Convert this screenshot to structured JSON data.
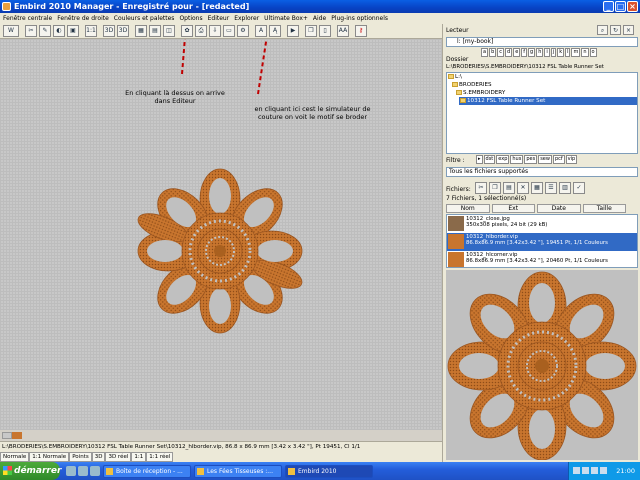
{
  "window": {
    "title": "Embird 2010 Manager - Enregistré pour - [redacted]"
  },
  "menu": [
    "Fenêtre centrale",
    "Fenêtre de droite",
    "Couleurs et palettes",
    "Options",
    "Editeur",
    "Explorer",
    "Ultimate Box+",
    "Aide",
    "Plug-ins optionnels"
  ],
  "annotations": {
    "editor_note": "En cliquant là dessus on arrive dans Editeur",
    "simulator_note": "en cliquant ici cest le simulateur de couture on voit le motif se broder"
  },
  "status": {
    "path": "L:\\BRODERIES\\S.EMBROIDERY\\10312 FSL Table Runner Set\\10312_hlborder.vip, 86.8 x 86.9 mm [3.42 x 3.42 \"], Pt 19451, Cl 1/1"
  },
  "view_tabs": [
    "Normale",
    "1:1 Normale",
    "Points",
    "3D",
    "3D réel",
    "1:1",
    "1:1 réel"
  ],
  "right_panel": {
    "lecteur_label": "Lecteur",
    "drive": "l: [my-book]",
    "dossier_label": "Dossier",
    "path": "L:\\BRODERIES\\S.EMBROIDERY\\10312 FSL Table Runner Set",
    "tree": [
      {
        "label": "L:\\",
        "indent": 0
      },
      {
        "label": "BRODERIES",
        "indent": 1
      },
      {
        "label": "S.EMBROIDERY",
        "indent": 2
      },
      {
        "label": "10312 FSL Table Runner Set",
        "indent": 3,
        "selected": true
      }
    ],
    "filter_label": "Filtre :",
    "filter_buttons": [
      "dst",
      "exp",
      "hus",
      "pes",
      "sew",
      "pcf",
      "vip"
    ],
    "filter_select": "Tous les fichiers supportés",
    "fichiers_label": "Fichiers:",
    "file_count": "7 Fichiers, 1 sélectionné(s)",
    "columns": [
      "Nom",
      "Ext",
      "Date",
      "Taille"
    ],
    "files": [
      {
        "name": "10312_close.jpg",
        "info": "350x308 pixels, 24 bit (29 kB)",
        "selected": false
      },
      {
        "name": "10312_hlborder.vip",
        "info": "86.8x86.9 mm [3.42x3.42 \"], 19451 Pt, 1/1 Couleurs",
        "selected": true
      },
      {
        "name": "10312_hlcorner.vip",
        "info": "86.8x86.9 mm [3.42x3.42 \"], 20460 Pt, 1/1 Couleurs",
        "selected": false
      }
    ]
  },
  "taskbar": {
    "start_label": "démarrer",
    "tasks": [
      "Boîte de réception - ...",
      "Les Fées Tisseuses :...",
      "Embird 2010"
    ],
    "clock": "21:00"
  },
  "colors": {
    "thread": "#c8752e",
    "swatch1": "#c8c8c8",
    "swatch2": "#c8752e"
  }
}
